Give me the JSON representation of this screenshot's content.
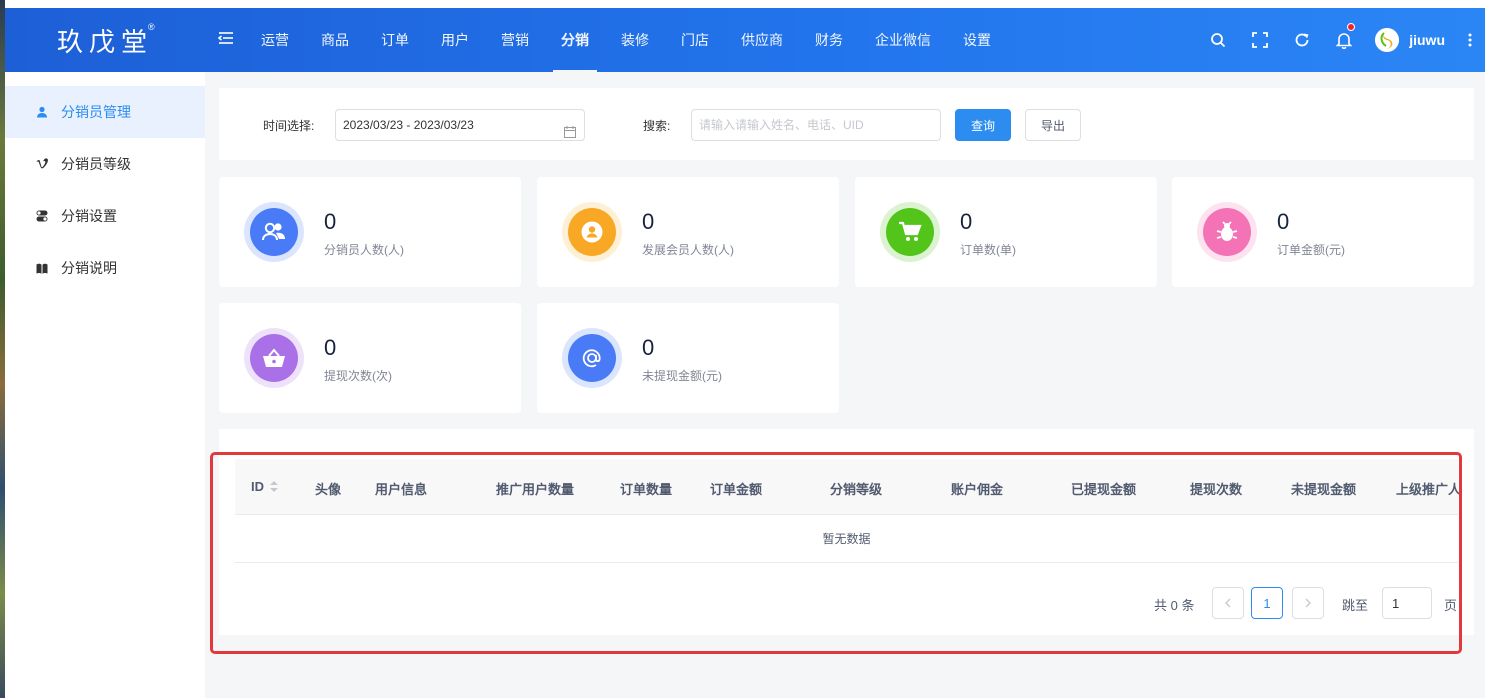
{
  "app": {
    "logo": "玖戊堂",
    "logo_mark": "®",
    "user_name": "jiuwu",
    "accent": "#2d8cf0"
  },
  "header": {
    "nav": [
      {
        "label": "运营",
        "active": false
      },
      {
        "label": "商品",
        "active": false
      },
      {
        "label": "订单",
        "active": false
      },
      {
        "label": "用户",
        "active": false
      },
      {
        "label": "营销",
        "active": false
      },
      {
        "label": "分销",
        "active": true
      },
      {
        "label": "装修",
        "active": false
      },
      {
        "label": "门店",
        "active": false
      },
      {
        "label": "供应商",
        "active": false
      },
      {
        "label": "财务",
        "active": false
      },
      {
        "label": "企业微信",
        "active": false
      },
      {
        "label": "设置",
        "active": false
      }
    ],
    "icons": [
      "search-icon",
      "fullscreen-icon",
      "refresh-icon",
      "bell-icon",
      "more-icon"
    ]
  },
  "sidebar": {
    "items": [
      {
        "label": "分销员管理",
        "icon": "user-icon",
        "active": true
      },
      {
        "label": "分销员等级",
        "icon": "vimeo-icon",
        "active": false
      },
      {
        "label": "分销设置",
        "icon": "toggle-icon",
        "active": false
      },
      {
        "label": "分销说明",
        "icon": "book-icon",
        "active": false
      }
    ]
  },
  "filter": {
    "date_label": "时间选择:",
    "date_value": "2023/03/23 - 2023/03/23",
    "search_label": "搜索:",
    "search_placeholder": "请输入请输入姓名、电话、UID",
    "query_button": "查询",
    "export_button": "导出"
  },
  "stats": [
    {
      "value": "0",
      "label": "分销员人数(人)",
      "color": "#4a7bf7",
      "ring": "#dbe5fd",
      "icon": "users-icon"
    },
    {
      "value": "0",
      "label": "发展会员人数(人)",
      "color": "#f9a825",
      "ring": "#fdf0d5",
      "icon": "user-circle-icon"
    },
    {
      "value": "0",
      "label": "订单数(单)",
      "color": "#52c41a",
      "ring": "#dcf3d2",
      "icon": "cart-icon"
    },
    {
      "value": "0",
      "label": "订单金额(元)",
      "color": "#f472b6",
      "ring": "#fde2ef",
      "icon": "bug-icon"
    },
    {
      "value": "0",
      "label": "提现次数(次)",
      "color": "#a970e8",
      "ring": "#eee2fb",
      "icon": "basket-icon"
    },
    {
      "value": "0",
      "label": "未提现金额(元)",
      "color": "#4a7bf7",
      "ring": "#dbe5fd",
      "icon": "at-icon"
    }
  ],
  "table": {
    "columns": [
      "ID",
      "头像",
      "用户信息",
      "推广用户数量",
      "订单数量",
      "订单金额",
      "分销等级",
      "账户佣金",
      "已提现金额",
      "提现次数",
      "未提现金额",
      "上级推广人"
    ],
    "empty_text": "暂无数据"
  },
  "pagination": {
    "total": "共 0 条",
    "current_page": "1",
    "jump_label": "跳至",
    "jump_value": "1",
    "page_suffix": "页"
  }
}
